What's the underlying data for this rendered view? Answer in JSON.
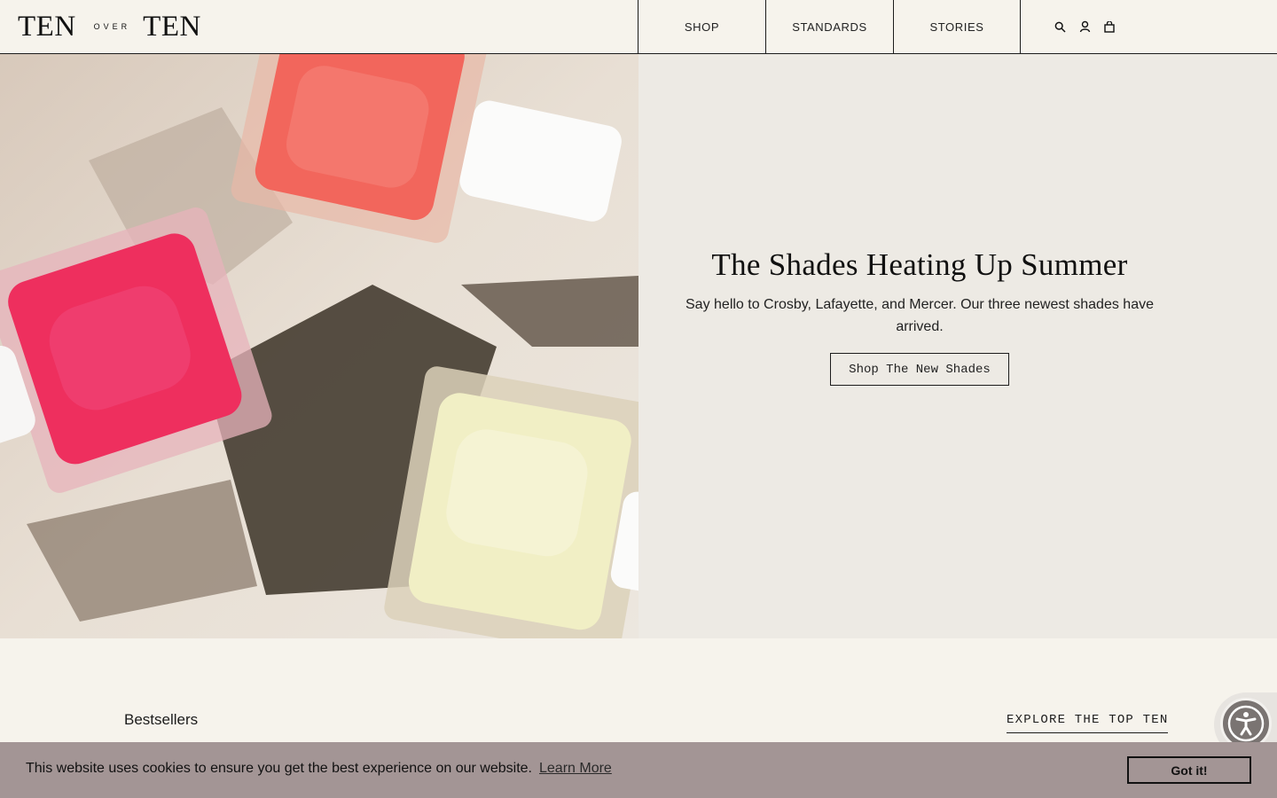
{
  "brand": {
    "word1": "TEN",
    "over": "OVER",
    "word2": "TEN"
  },
  "nav": [
    {
      "label": "SHOP"
    },
    {
      "label": "STANDARDS"
    },
    {
      "label": "STORIES"
    }
  ],
  "header_icons": [
    "search-icon",
    "account-icon",
    "bag-icon"
  ],
  "hero": {
    "title": "The Shades Heating Up Summer",
    "subtitle": "Say hello to Crosby, Lafayette, and Mercer. Our three newest shades have arrived.",
    "cta": "Shop The New Shades",
    "image_colors": {
      "coral": "#f2665c",
      "pink": "#ee2f5e",
      "cream": "#f1efc5",
      "background": "#e6dcd1"
    }
  },
  "bestsellers": {
    "title": "Bestsellers",
    "link": "EXPLORE THE TOP TEN"
  },
  "cookie": {
    "message": "This website uses cookies to ensure you get the best experience on our website.",
    "learn_more": "Learn More",
    "button": "Got it!"
  },
  "accessibility_icon": "accessibility-icon"
}
